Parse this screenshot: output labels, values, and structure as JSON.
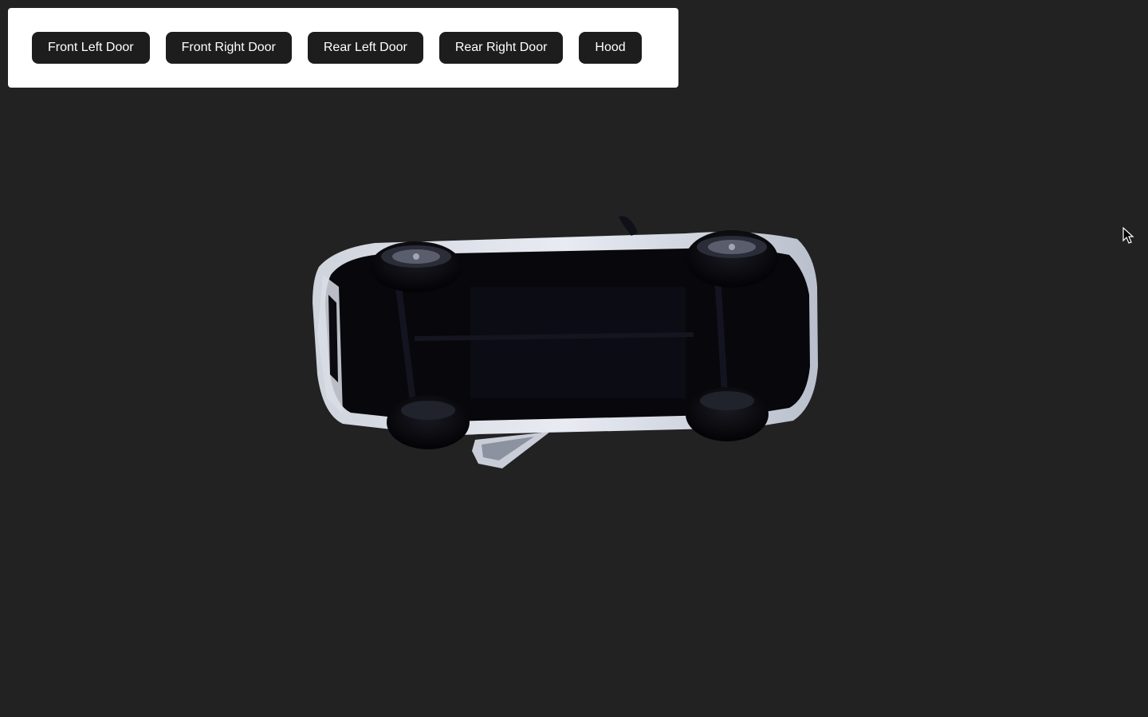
{
  "controls": {
    "buttons": [
      {
        "label": "Front Left Door"
      },
      {
        "label": "Front Right Door"
      },
      {
        "label": "Rear Left Door"
      },
      {
        "label": "Rear Right Door"
      },
      {
        "label": "Hood"
      }
    ]
  },
  "scene": {
    "background_color": "#222222",
    "subject": "car-3d-model-underside"
  },
  "cursor": {
    "icon": "pointer-arrow-icon"
  }
}
